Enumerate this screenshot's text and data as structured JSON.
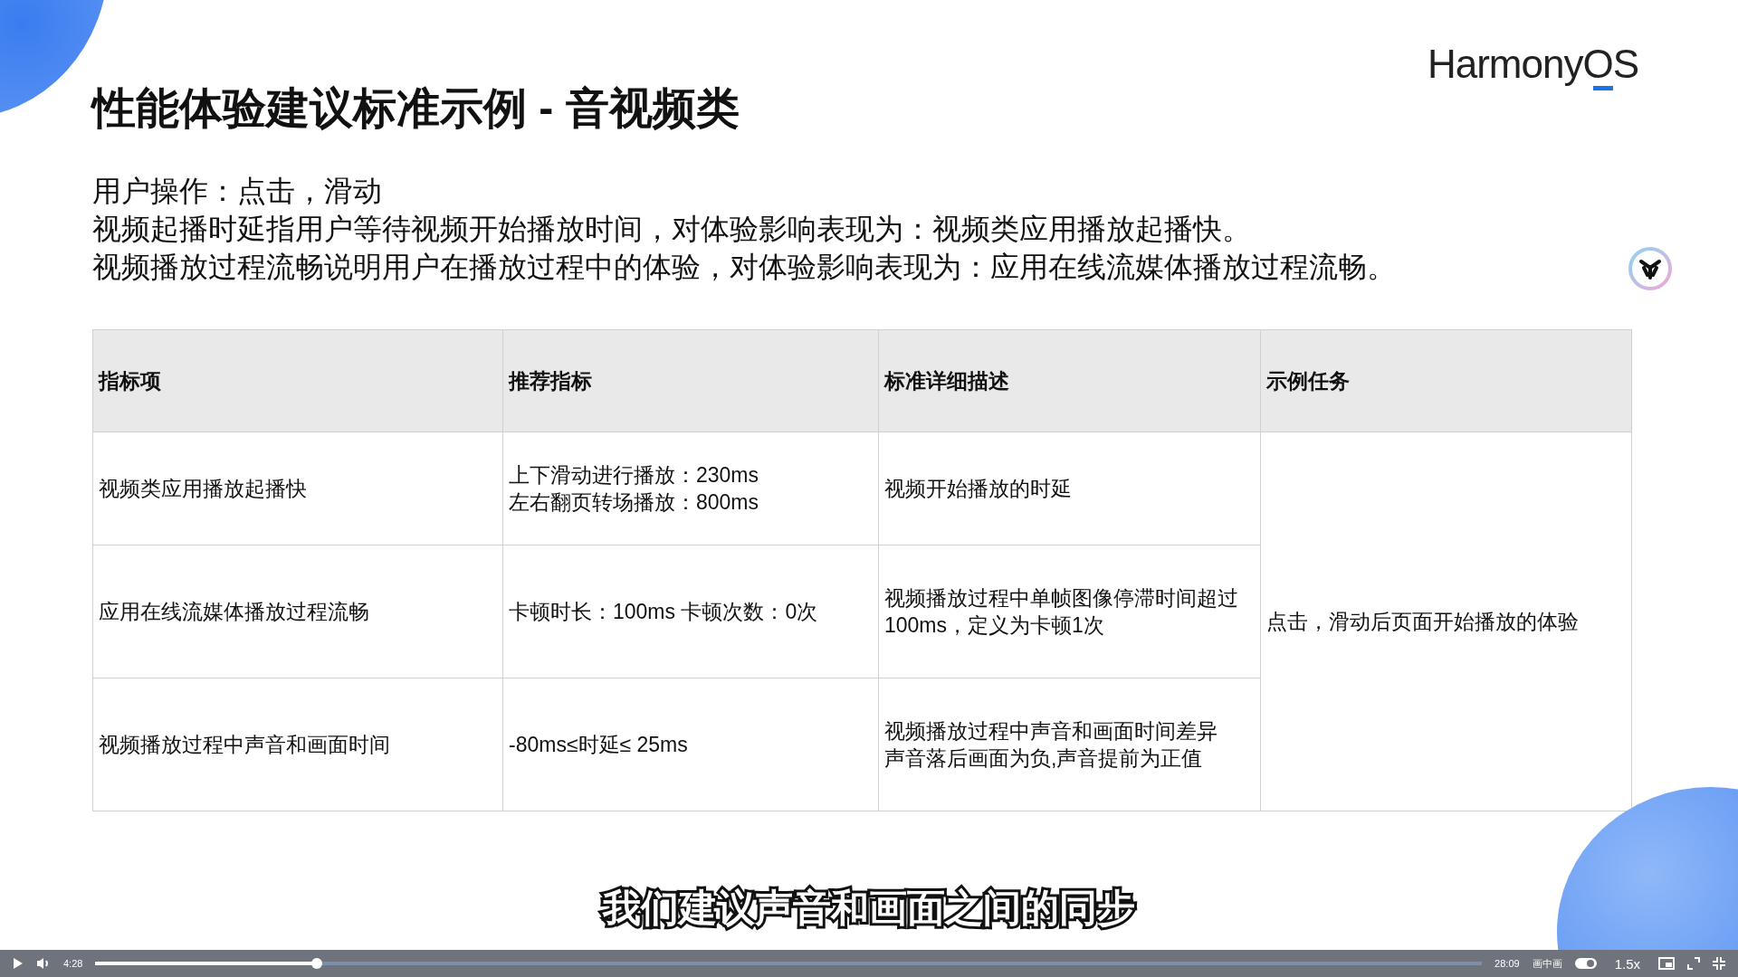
{
  "slide": {
    "title": "性能体验建议标准示例 - 音视频类",
    "logo": "HarmonyOS",
    "intro": [
      "用户操作：点击，滑动",
      "视频起播时延指用户等待视频开始播放时间，对体验影响表现为：视频类应用播放起播快。",
      "视频播放过程流畅说明用户在播放过程中的体验，对体验影响表现为：应用在线流媒体播放过程流畅。"
    ],
    "table": {
      "columns": [
        "指标项",
        "推荐指标",
        "标准详细描述",
        "示例任务"
      ],
      "rows": [
        {
          "cells": [
            [
              "视频类应用播放起播快"
            ],
            [
              "上下滑动进行播放：230ms",
              "左右翻页转场播放：800ms"
            ],
            [
              "视频开始播放的时延"
            ]
          ]
        },
        {
          "cells": [
            [
              "应用在线流媒体播放过程流畅"
            ],
            [
              "卡顿时长：100ms 卡顿次数：0次"
            ],
            [
              "视频播放过程中单帧图像停滞时间超过100ms，定义为卡顿1次"
            ]
          ]
        },
        {
          "cells": [
            [
              "视频播放过程中声音和画面时间"
            ],
            [
              "-80ms≤时延≤ 25ms"
            ],
            [
              "视频播放过程中声音和画面时间差异",
              "声音落后画面为负,声音提前为正值"
            ]
          ]
        }
      ],
      "merged_cell": "点击，滑动后页面开始播放的体验"
    }
  },
  "subtitle": "我们建议声音和画面之间的同步",
  "player": {
    "current_time": "4:28",
    "duration": "28:09",
    "progress": {
      "level": 0.16
    },
    "pip_label": "画中画",
    "pip": {
      "on": true
    },
    "speed": "1.5x"
  }
}
